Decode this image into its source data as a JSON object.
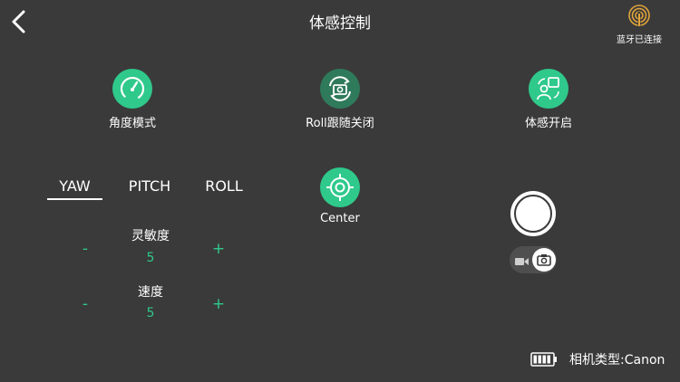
{
  "header": {
    "title": "体感控制",
    "bluetooth_status": "蓝牙已连接",
    "back_icon": "chevron-left-icon",
    "bluetooth_icon": "signal-icon"
  },
  "modes": [
    {
      "label": "角度模式",
      "icon": "speedometer-icon"
    },
    {
      "label": "Roll跟随关闭",
      "icon": "rotate-camera-icon"
    },
    {
      "label": "体感开启",
      "icon": "motion-sense-icon"
    }
  ],
  "center_button": {
    "label": "Center",
    "icon": "crosshair-icon"
  },
  "axis_tabs": {
    "active": "YAW",
    "items": [
      "YAW",
      "PITCH",
      "ROLL"
    ]
  },
  "params": {
    "sensitivity": {
      "label": "灵敏度",
      "value": "5",
      "minus": "-",
      "plus": "+"
    },
    "speed": {
      "label": "速度",
      "value": "5",
      "minus": "-",
      "plus": "+"
    }
  },
  "capture": {
    "mode": "photo",
    "video_icon": "video-icon",
    "photo_icon": "camera-icon",
    "shutter_icon": "shutter-icon"
  },
  "footer": {
    "battery_icon": "battery-icon",
    "battery_level": 1.0,
    "camera_type": "相机类型:Canon"
  },
  "colors": {
    "background": "#3a3a3a",
    "accent": "#2fc98b",
    "accent_dark": "#2f7a5b",
    "text": "#ffffff"
  }
}
